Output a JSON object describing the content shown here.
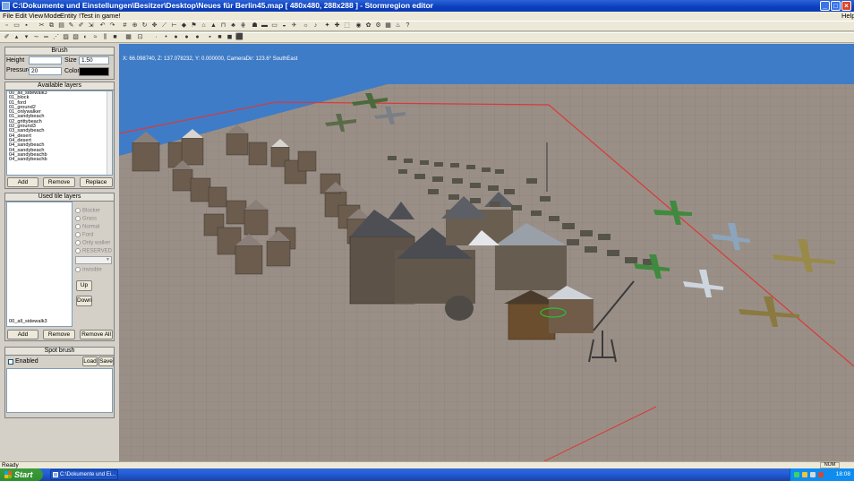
{
  "window": {
    "title": "C:\\Dokumente und Einstellungen\\Besitzer\\Desktop\\Neues für Berlin45.map [ 480x480, 288x288 ] - Stormregion editor",
    "buttons": {
      "minimize": "_",
      "maximize": "□",
      "close": "×"
    }
  },
  "menu": {
    "file": "File",
    "edit": "Edit",
    "view": "View",
    "mode": "Mode",
    "entity": "Entity",
    "test": "!Test in game!",
    "help": "Help"
  },
  "brush": {
    "title": "Brush",
    "height_label": "Height",
    "height_value": "",
    "size_label": "Size",
    "size_value": "1.50",
    "pressure_label": "Pressure",
    "pressure_value": "20",
    "color_label": "Color",
    "color_value": "#000000"
  },
  "available_layers": {
    "title": "Available layers",
    "items": [
      "00_all_sidewalk3",
      "01_block",
      "01_ford",
      "01_ground2",
      "01_onlywalker",
      "01_sandybeach",
      "02_grittybeach",
      "02_ground3",
      "03_sandybeach",
      "04_desert",
      "04_desert",
      "04_sandybeach",
      "04_sandybeach",
      "04_sandybeachb",
      "04_sandybeachb"
    ],
    "add": "Add",
    "remove": "Remove",
    "replace": "Replace"
  },
  "used_layers": {
    "title": "Used tile layers",
    "list_bottom": "00_all_sidewalk3",
    "radio": [
      "Blocker",
      "Grass",
      "Normal",
      "Ford",
      "Only walker",
      "RESERVED"
    ],
    "invisible": "Invisible",
    "up": "Up",
    "down": "Down",
    "add": "Add",
    "remove": "Remove",
    "remove_all": "Remove All"
  },
  "spot_brush": {
    "title": "Spot brush",
    "enabled": "Enabled",
    "load": "Load",
    "save": "Save"
  },
  "viewport": {
    "coords": "X: 66.098740, Z: 137.078232, Y: 0.000000,  CameraDir: 123.6° SouthEast"
  },
  "status": {
    "text": "Ready",
    "num": "NUM"
  },
  "taskbar": {
    "start": "Start",
    "task": "C:\\Dokumente und Ei...",
    "clock": "18:08"
  }
}
